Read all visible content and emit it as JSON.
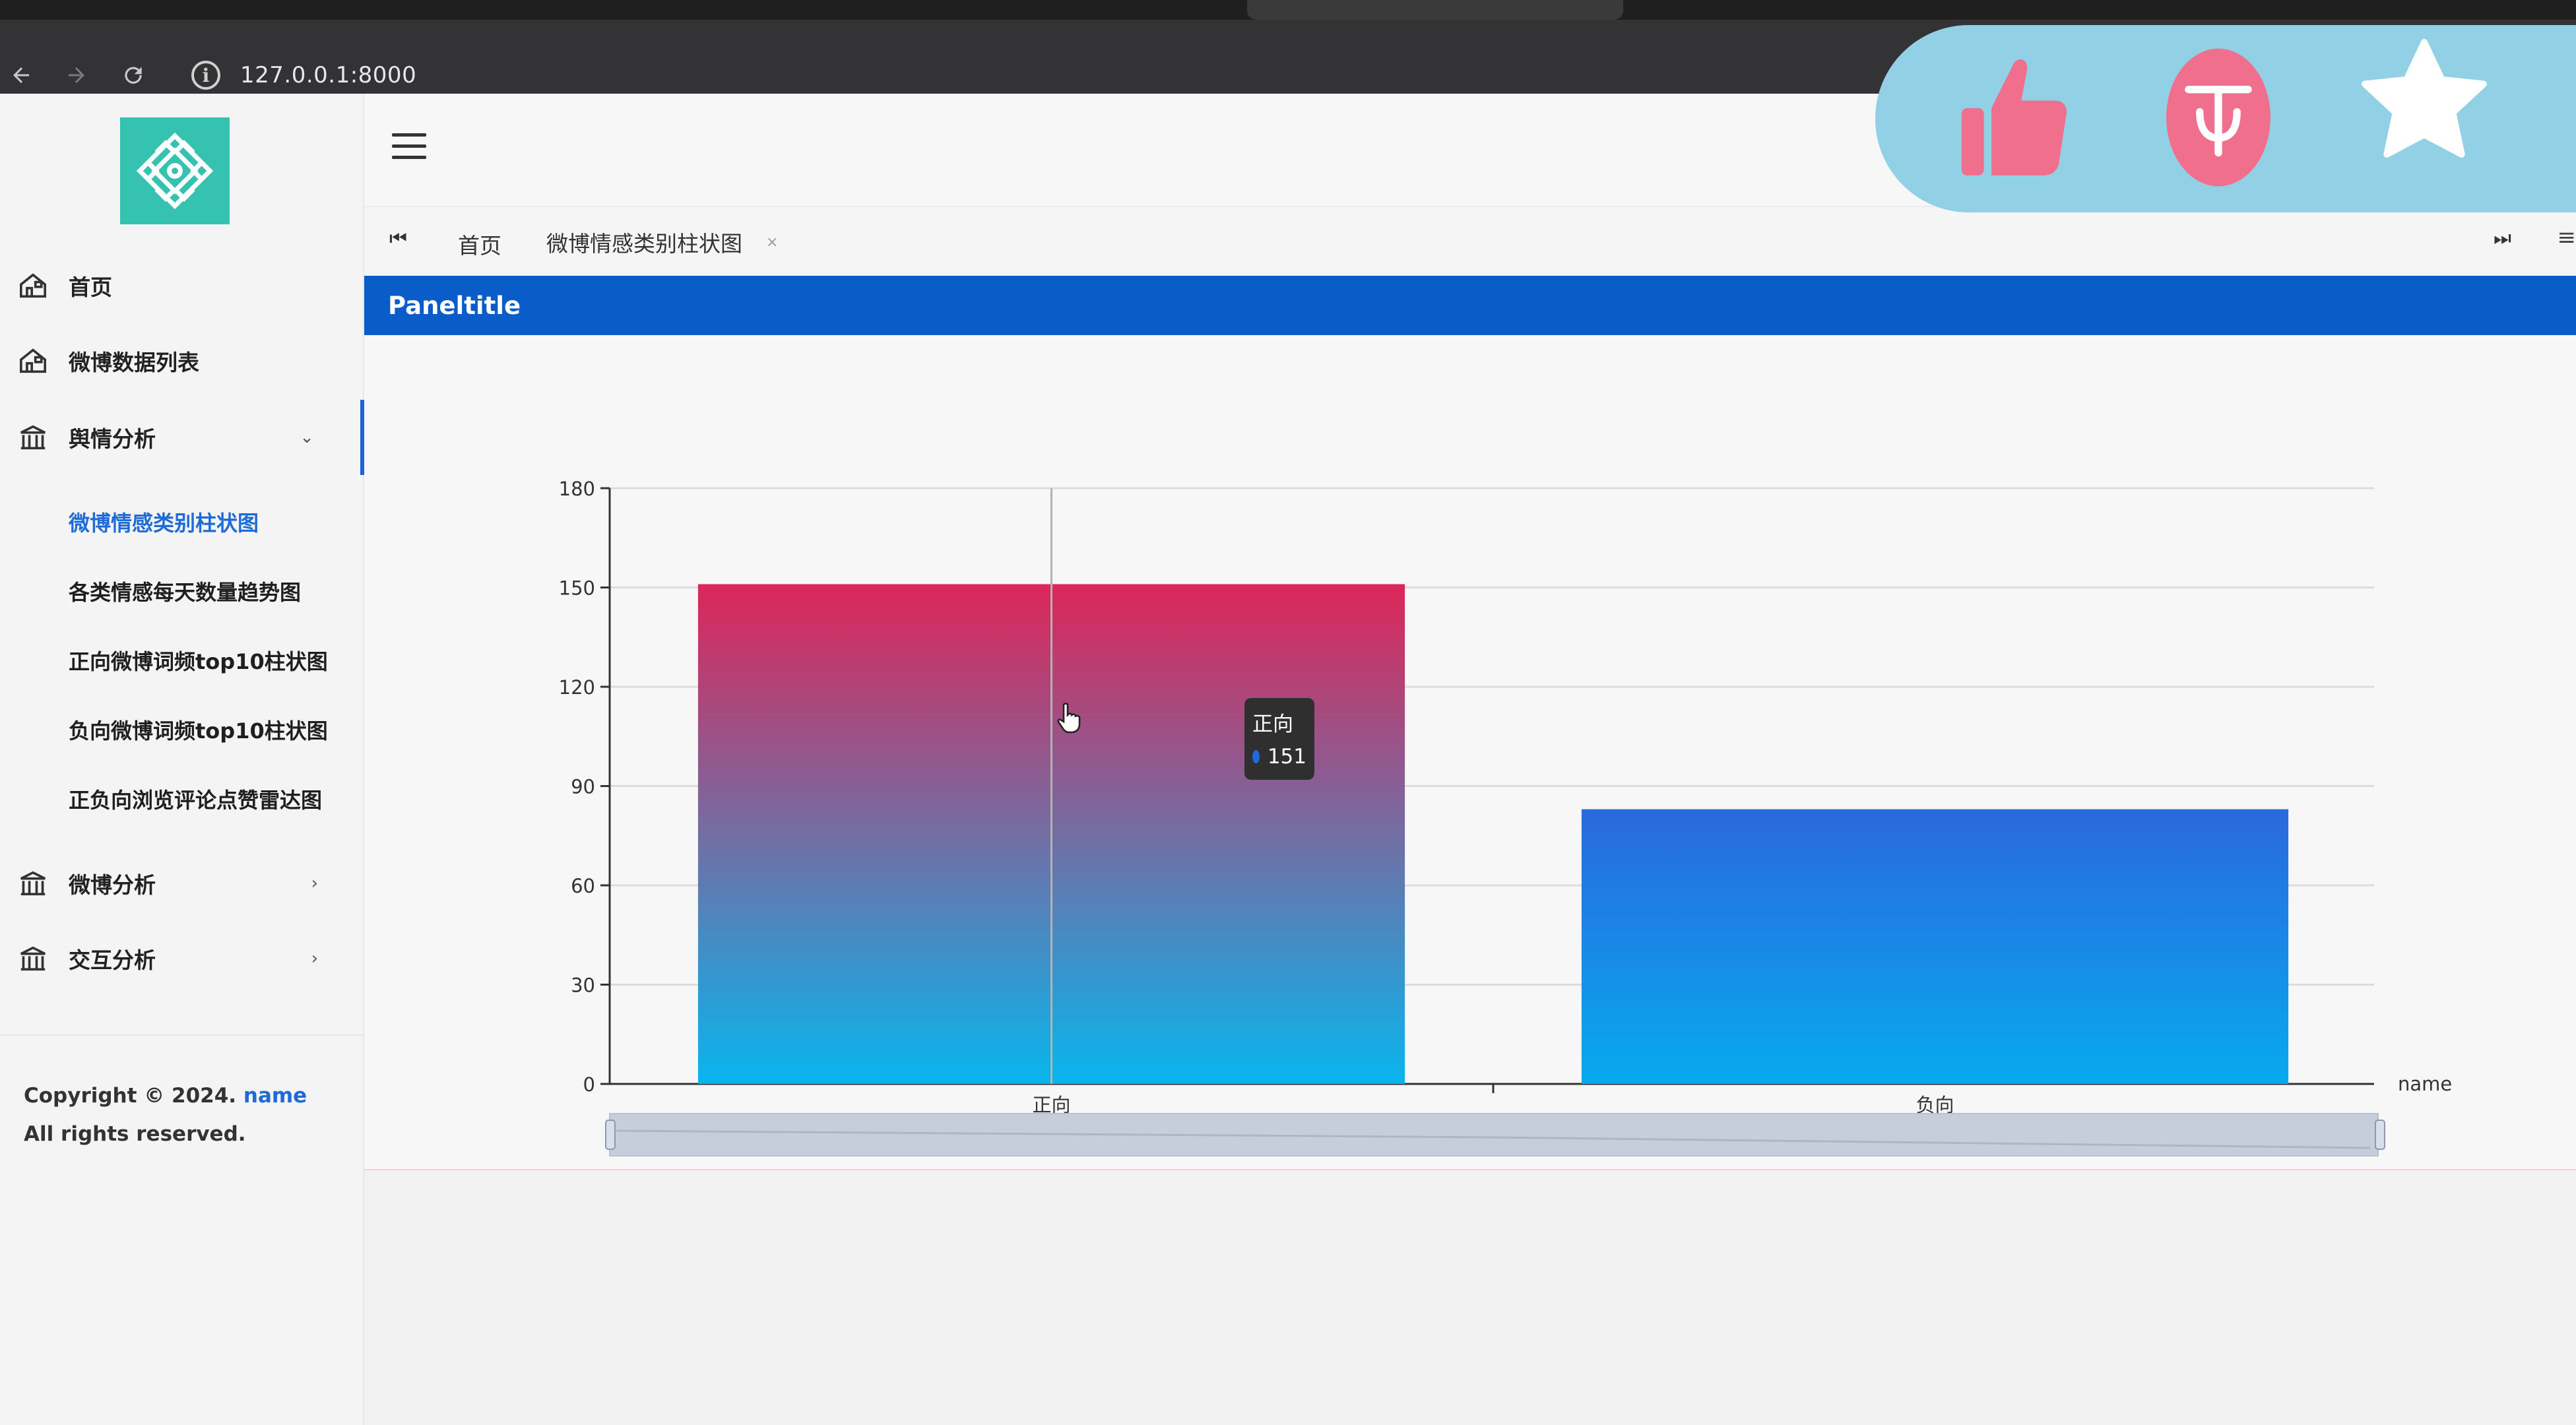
{
  "browser": {
    "url": "127.0.0.1:8000",
    "back_icon": "back-arrow-icon",
    "forward_icon": "forward-arrow-icon",
    "reload_icon": "reload-icon",
    "info_icon": "info-icon"
  },
  "sidebar": {
    "logo": "app-logo",
    "items": [
      {
        "label": "首页",
        "icon": "home-icon"
      },
      {
        "label": "微博数据列表",
        "icon": "home-icon"
      },
      {
        "label": "舆情分析",
        "icon": "bank-icon",
        "expanded": true
      },
      {
        "label": "微博分析",
        "icon": "bank-icon"
      },
      {
        "label": "交互分析",
        "icon": "bank-icon"
      }
    ],
    "subitems": [
      {
        "label": "微博情感类别柱状图",
        "active": true
      },
      {
        "label": "各类情感每天数量趋势图"
      },
      {
        "label": "正向微博词频top10柱状图"
      },
      {
        "label": "负向微博词频top10柱状图"
      },
      {
        "label": "正负向浏览评论点赞雷达图"
      }
    ],
    "copyright_prefix": "Copyright © 2024.",
    "copyright_link": "name",
    "copyright_suffix": "All rights reserved."
  },
  "tabs": [
    {
      "label": "首页",
      "active": false
    },
    {
      "label": "微博情感类别柱状图",
      "active": true,
      "close": "×"
    }
  ],
  "panel": {
    "title": "Paneltitle"
  },
  "tooltip": {
    "title": "正向",
    "value": "151",
    "dot_color": "#1e6ad8"
  },
  "overlay": {
    "buttons": [
      "like-icon",
      "coin-icon",
      "favorite-icon"
    ],
    "bg_color": "#92d0e6",
    "accent_color": "#ef6f8c"
  },
  "colors": {
    "accent": "#1e63d6",
    "panel_header": "#0a5dc8",
    "logo": "#35c2b0"
  },
  "chart_data": {
    "type": "bar",
    "categories": [
      "正向",
      "负向"
    ],
    "values": [
      151,
      83
    ],
    "ylim": [
      0,
      180
    ],
    "yticks": [
      0,
      30,
      60,
      90,
      120,
      150,
      180
    ],
    "xlabel": "name",
    "ylabel": "",
    "grid": true,
    "gradients": [
      {
        "top": "#dd2659",
        "bottom": "#08b5ee"
      },
      {
        "top": "#2a68de",
        "bottom": "#07aaee"
      }
    ],
    "has_datazoom": true
  }
}
